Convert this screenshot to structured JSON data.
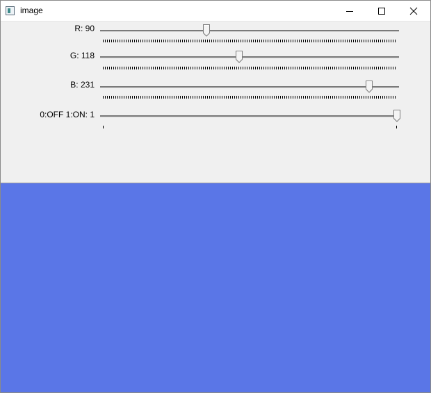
{
  "window": {
    "title": "image",
    "icon": "window-app-icon",
    "controls": [
      "minimize-icon",
      "maximize-icon",
      "close-icon"
    ]
  },
  "trackbars": [
    {
      "label": "R: 90",
      "value": 90,
      "max": 255
    },
    {
      "label": "G: 118",
      "value": 118,
      "max": 255
    },
    {
      "label": "B: 231",
      "value": 231,
      "max": 255
    },
    {
      "label": "0:OFF 1:ON: 1",
      "value": 1,
      "max": 1
    }
  ],
  "display": {
    "color": "#5a76e7"
  }
}
